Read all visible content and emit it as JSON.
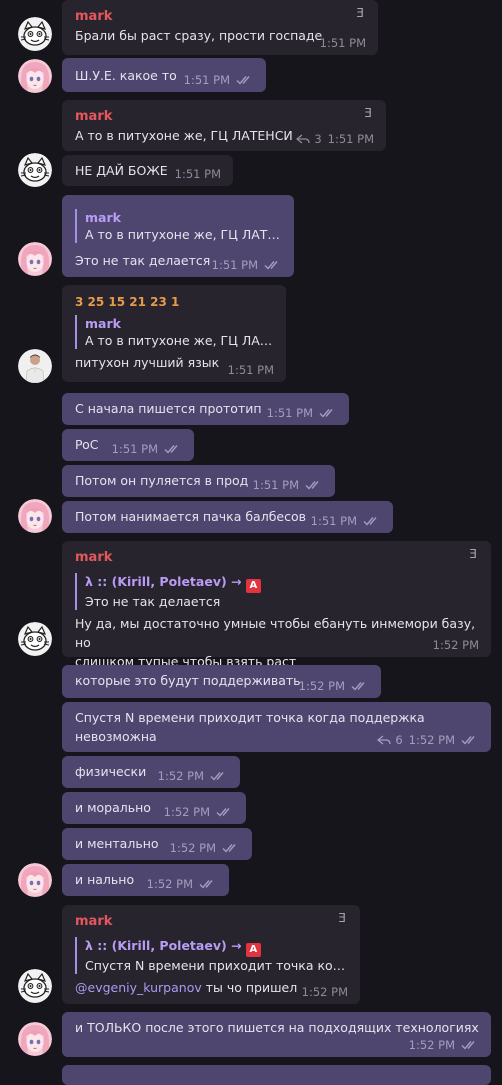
{
  "icons": {
    "reply": "reply-arrow-icon",
    "read": "double-check-icon"
  },
  "colors": {
    "background": "#17151c",
    "incoming": "#27242d",
    "outgoing": "#4f4670",
    "accent": "#a890e8"
  },
  "messages": [
    {
      "sender": "mark",
      "handle": "Ǝ",
      "text": "Брали бы раст сразу, прости госпаде",
      "time": "1:51 PM"
    },
    {
      "text": "Ш.У.Е. какое то",
      "time": "1:51 PM"
    },
    {
      "sender": "mark",
      "handle": "Ǝ",
      "text": "А то в питухоне же, ГЦ ЛАТЕНСИ",
      "replies": "3",
      "time": "1:51 PM"
    },
    {
      "text": "НЕ ДАЙ БОЖЕ",
      "time": "1:51 PM"
    },
    {
      "quote_name": "mark",
      "quote_text": "А то в питухоне же, ГЦ ЛАТЕН...",
      "text": "Это не так делается",
      "time": "1:51 PM"
    },
    {
      "sender": "3 25 15 21 23 1",
      "quote_name": "mark",
      "quote_text": "А то в питухоне же, ГЦ ЛАТЕ...",
      "text": "питухон лучший язык",
      "time": "1:51 PM"
    },
    {
      "text": "С начала пишется прототип",
      "time": "1:51 PM"
    },
    {
      "text": "PoC",
      "time": "1:51 PM"
    },
    {
      "text": "Потом он пуляется в прод",
      "time": "1:51 PM"
    },
    {
      "text": "Потом нанимается пачка балбесов",
      "time": "1:51 PM"
    },
    {
      "sender": "mark",
      "handle": "Ǝ",
      "quote_name": "λ :: (Kirill, Poletaev) → ",
      "quote_text": "Это не так делается",
      "text_line1": "Ну да, мы достаточно умные чтобы ебануть инмемори базу, но",
      "text_line2": "слишком тупые чтобы взять раст",
      "time": "1:52 PM"
    },
    {
      "text": "которые это будут поддерживать",
      "time": "1:52 PM"
    },
    {
      "text_line1": "Спустя N времени приходит точка когда поддержка",
      "text_line2": "невозможна",
      "replies": "6",
      "time": "1:52 PM"
    },
    {
      "text": "физически",
      "time": "1:52 PM"
    },
    {
      "text": "и морально",
      "time": "1:52 PM"
    },
    {
      "text": "и ментально",
      "time": "1:52 PM"
    },
    {
      "text": "и нально",
      "time": "1:52 PM"
    },
    {
      "sender": "mark",
      "handle": "Ǝ",
      "quote_name": "λ :: (Kirill, Poletaev) → ",
      "quote_text": "Спустя N времени приходит точка когд...",
      "mention": "@evgeniy_kurpanov",
      "text": " ты чо пришел",
      "time": "1:52 PM"
    },
    {
      "text": "и ТОЛЬКО после этого пишется на подходящих технологиях",
      "time": "1:52 PM"
    }
  ],
  "badge_letter": "A"
}
